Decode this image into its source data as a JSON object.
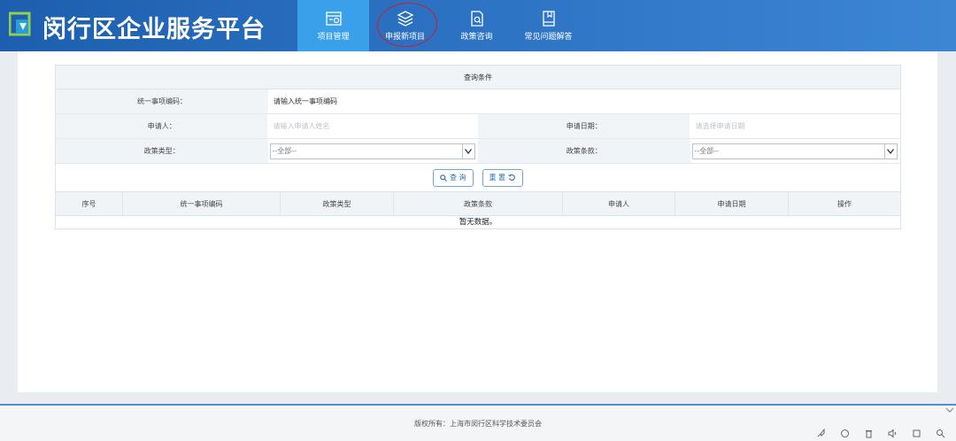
{
  "header": {
    "brand": "闵行区企业服务平台",
    "nav": [
      {
        "label": "项目管理",
        "icon": "folder-settings-icon",
        "active": true
      },
      {
        "label": "申报新项目",
        "icon": "layers-icon",
        "active": false
      },
      {
        "label": "政策咨询",
        "icon": "document-search-icon",
        "active": false
      },
      {
        "label": "常见问题解答",
        "icon": "book-icon",
        "active": false
      }
    ]
  },
  "query": {
    "title": "查询条件",
    "code_label": "统一事项编码：",
    "code_value": "请输入统一事项编码",
    "applicant_label": "申请人：",
    "applicant_placeholder": "请输入申请人姓名",
    "date_label": "申请日期：",
    "date_placeholder": "请选择申请日期",
    "policy_type_label": "政策类型：",
    "policy_type_value": "--全部--",
    "policy_clause_label": "政策条款：",
    "policy_clause_value": "--全部--",
    "search_label": "查 询",
    "reset_label": "重 置"
  },
  "table": {
    "columns": [
      "序号",
      "统一事项编码",
      "政策类型",
      "政策条款",
      "申请人",
      "申请日期",
      "操作"
    ],
    "empty": "暂无数据。"
  },
  "footer": {
    "copyright": "版权所有：上海市闵行区科学技术委员会"
  }
}
